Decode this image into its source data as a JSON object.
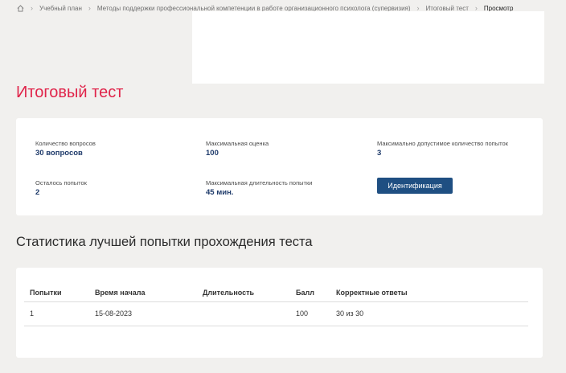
{
  "breadcrumb": {
    "items": [
      "Учебный план",
      "Методы поддержки профессиональной компетенции в работе организационного психолога (супервизия)",
      "Итоговый тест"
    ],
    "current": "Просмотр"
  },
  "page": {
    "title": "Итоговый тест"
  },
  "test_info": {
    "questions_label": "Количество вопросов",
    "questions_value": "30 вопросов",
    "max_score_label": "Максимальная оценка",
    "max_score_value": "100",
    "max_attempts_label": "Максимально допустимое количество попыток",
    "max_attempts_value": "3",
    "remaining_label": "Осталось попыток",
    "remaining_value": "2",
    "duration_label": "Максимальная длительность попытки",
    "duration_value": "45 мин.",
    "identify_button": "Идентификация"
  },
  "stats": {
    "title": "Статистика лучшей попытки прохождения теста",
    "columns": [
      "Попытки",
      "Время начала",
      "Длительность",
      "Балл",
      "Корректные ответы"
    ],
    "rows": [
      [
        "1",
        "15-08-2023",
        "",
        "100",
        "30 из 30"
      ]
    ]
  },
  "colors": {
    "title": "#e0244a",
    "button": "#1f4f82",
    "value": "#1e3a6a"
  }
}
